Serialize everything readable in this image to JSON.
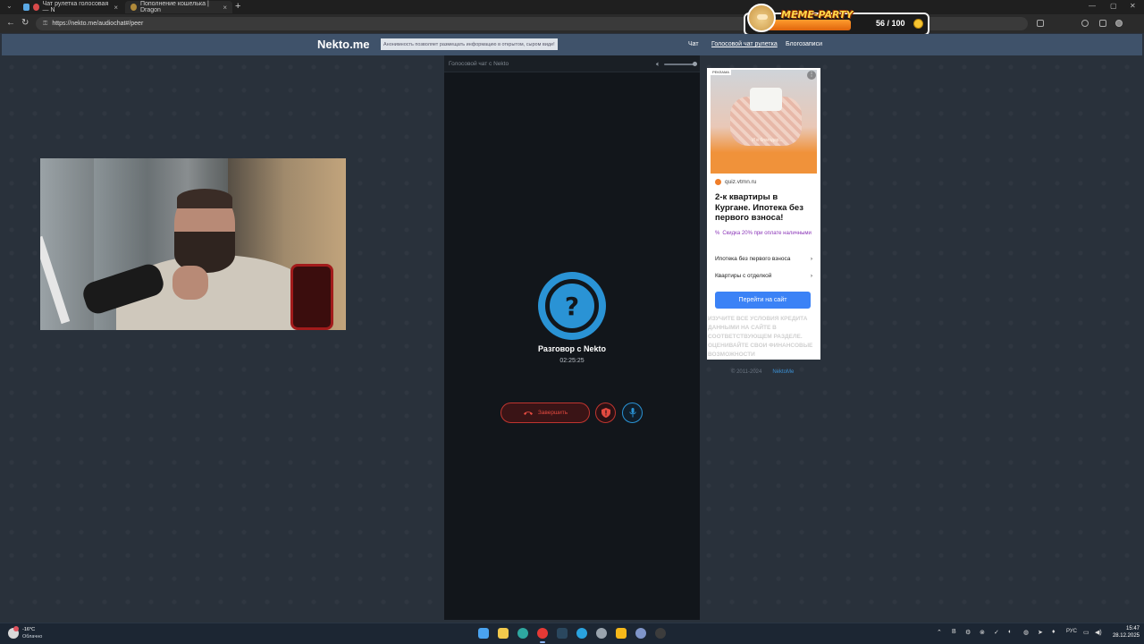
{
  "browser": {
    "tabs": [
      {
        "label": "Чат рулетка голосовая — N",
        "close": "×"
      },
      {
        "label": "Пополнение кошелька | Dragon",
        "close": "×"
      }
    ],
    "new_tab": "+",
    "url": "https://nekto.me/audiochat#/peer",
    "window_controls": [
      "—",
      "▢",
      "✕"
    ]
  },
  "overlay": {
    "title": "MEME-PARTY",
    "score": "56 / 100"
  },
  "header": {
    "logo": "Nekto.me",
    "notice": "Анонимность позволяет размещать информацию в открытом, сыром виде!",
    "nav": [
      {
        "label": "Чат"
      },
      {
        "label": "Голосовой чат рулетка"
      },
      {
        "label": "Блогозаписи"
      }
    ]
  },
  "chat": {
    "panel_title": "Голосовой чат с Nekto",
    "avatar_symbol": "?",
    "conversation_title": "Разговор с Nekto",
    "timer": "02:25:25",
    "end_button": "Завершить",
    "volume_level": 1.0
  },
  "ad": {
    "tag": "РЕКЛАМА",
    "more": "⋮",
    "image_text": "И в благодар...",
    "source": "quiz.vtmn.ru",
    "headline": "2-к квартиры в Кургане. Ипотека без первого взноса!",
    "promo_icon": "%",
    "promo": "Скидка 20% при оплате наличными",
    "links": [
      {
        "label": "Ипотека без первого взноса",
        "arrow": "›"
      },
      {
        "label": "Квартиры с отделкой",
        "arrow": "›"
      }
    ],
    "cta": "Перейти на сайт",
    "disclaimer": "ИЗУЧИТЕ ВСЕ УСЛОВИЯ КРЕДИТА ДАННЫМИ НА САЙТЕ В СООТВЕТСТВУЮЩЕМ РАЗДЕЛЕ. ОЦЕНИВАЙТЕ СВОИ ФИНАНСОВЫЕ ВОЗМОЖНОСТИ"
  },
  "footer": {
    "copyright": "© 2011-2024",
    "link": "NektoMe"
  },
  "taskbar": {
    "weather_temp": "-16°C",
    "weather_desc": "Облачно",
    "lang": "РУС",
    "time": "15:47",
    "date": "28.12.2025"
  },
  "colors": {
    "accent_blue": "#2a93d5",
    "end_red": "#e44a40",
    "header_bg": "#3f526a",
    "ad_cta": "#3b82f6"
  }
}
